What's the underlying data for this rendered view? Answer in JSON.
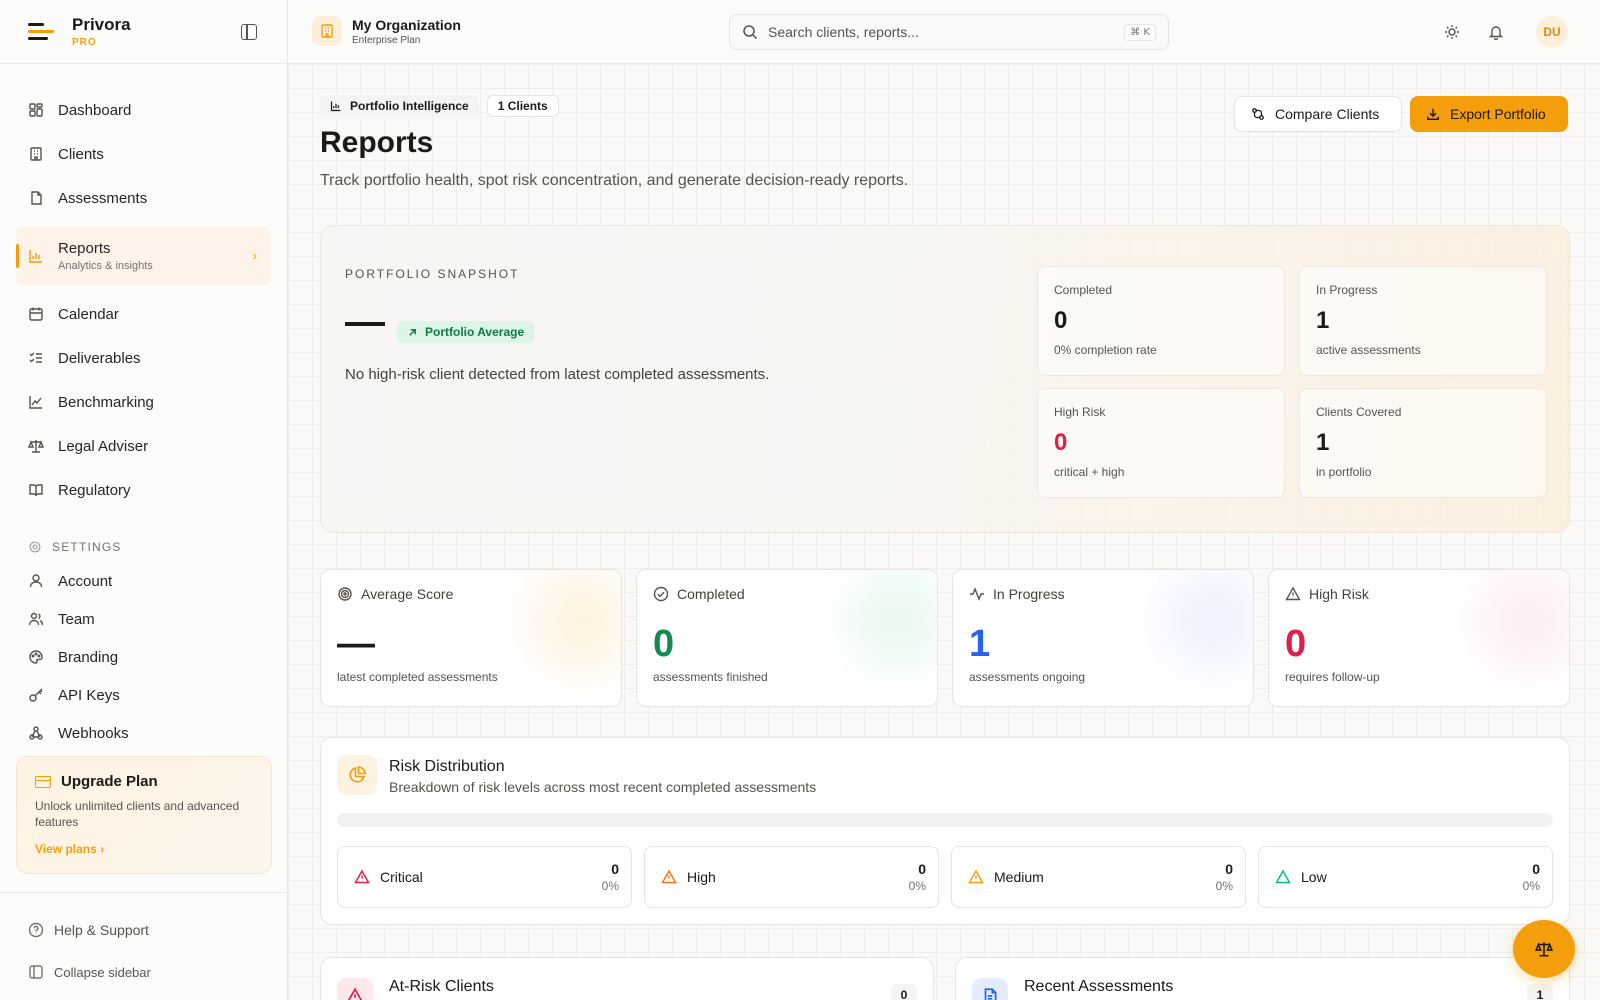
{
  "brand": {
    "name": "Privora",
    "tier": "PRO"
  },
  "sidebar": {
    "items": [
      {
        "label": "Dashboard",
        "icon": "dashboard-icon"
      },
      {
        "label": "Clients",
        "icon": "building-icon"
      },
      {
        "label": "Assessments",
        "icon": "file-icon"
      },
      {
        "label": "Reports",
        "sub": "Analytics & insights",
        "icon": "bar-chart-icon",
        "active": true
      },
      {
        "label": "Calendar",
        "icon": "calendar-icon"
      },
      {
        "label": "Deliverables",
        "icon": "list-check-icon"
      },
      {
        "label": "Benchmarking",
        "icon": "line-chart-icon"
      },
      {
        "label": "Legal Adviser",
        "icon": "scale-icon"
      },
      {
        "label": "Regulatory",
        "icon": "book-icon"
      }
    ],
    "settings_heading": "SETTINGS",
    "settings_items": [
      {
        "label": "Account",
        "icon": "user-icon"
      },
      {
        "label": "Team",
        "icon": "users-icon"
      },
      {
        "label": "Branding",
        "icon": "palette-icon"
      },
      {
        "label": "API Keys",
        "icon": "key-icon"
      },
      {
        "label": "Webhooks",
        "icon": "webhook-icon"
      }
    ],
    "upgrade": {
      "title": "Upgrade Plan",
      "desc": "Unlock unlimited clients and advanced features",
      "link": "View plans ›"
    },
    "footer": {
      "help": "Help & Support",
      "collapse": "Collapse sidebar"
    }
  },
  "topbar": {
    "org_name": "My Organization",
    "org_plan": "Enterprise Plan",
    "search_placeholder": "Search clients, reports...",
    "shortcut": "⌘ K",
    "avatar_initials": "DU"
  },
  "header": {
    "chip_intel": "Portfolio Intelligence",
    "chip_clients": "1 Clients",
    "title": "Reports",
    "desc": "Track portfolio health, spot risk concentration, and generate decision-ready reports.",
    "compare_label": "Compare Clients",
    "export_label": "Export Portfolio"
  },
  "snapshot": {
    "label": "PORTFOLIO SNAPSHOT",
    "badge": "Portfolio Average",
    "message": "No high-risk client detected from latest completed assessments.",
    "stats": [
      {
        "label": "Completed",
        "value": "0",
        "sub": "0% completion rate"
      },
      {
        "label": "In Progress",
        "value": "1",
        "sub": "active assessments"
      },
      {
        "label": "High Risk",
        "value": "0",
        "sub": "critical + high"
      },
      {
        "label": "Clients Covered",
        "value": "1",
        "sub": "in portfolio"
      }
    ]
  },
  "kpis": [
    {
      "label": "Average Score",
      "value": "—",
      "caption": "latest completed assessments",
      "color": "#1c1917",
      "glow": "#fde7c2"
    },
    {
      "label": "Completed",
      "value": "0",
      "caption": "assessments finished",
      "color": "#15894f",
      "glow": "#d4f3e0"
    },
    {
      "label": "In Progress",
      "value": "1",
      "caption": "assessments ongoing",
      "color": "#2563eb",
      "glow": "#dbe6fd"
    },
    {
      "label": "High Risk",
      "value": "0",
      "caption": "requires follow-up",
      "color": "#e11d48",
      "glow": "#fddde3"
    }
  ],
  "risk": {
    "title": "Risk Distribution",
    "subtitle": "Breakdown of risk levels across most recent completed assessments",
    "levels": [
      {
        "name": "Critical",
        "count": "0",
        "pct": "0%",
        "color": "#e11d48"
      },
      {
        "name": "High",
        "count": "0",
        "pct": "0%",
        "color": "#f97316"
      },
      {
        "name": "Medium",
        "count": "0",
        "pct": "0%",
        "color": "#f59e0b"
      },
      {
        "name": "Low",
        "count": "0",
        "pct": "0%",
        "color": "#10b981"
      }
    ]
  },
  "panels": {
    "at_risk": {
      "title": "At-Risk Clients",
      "count": "0"
    },
    "recent": {
      "title": "Recent Assessments",
      "count": "1"
    }
  }
}
